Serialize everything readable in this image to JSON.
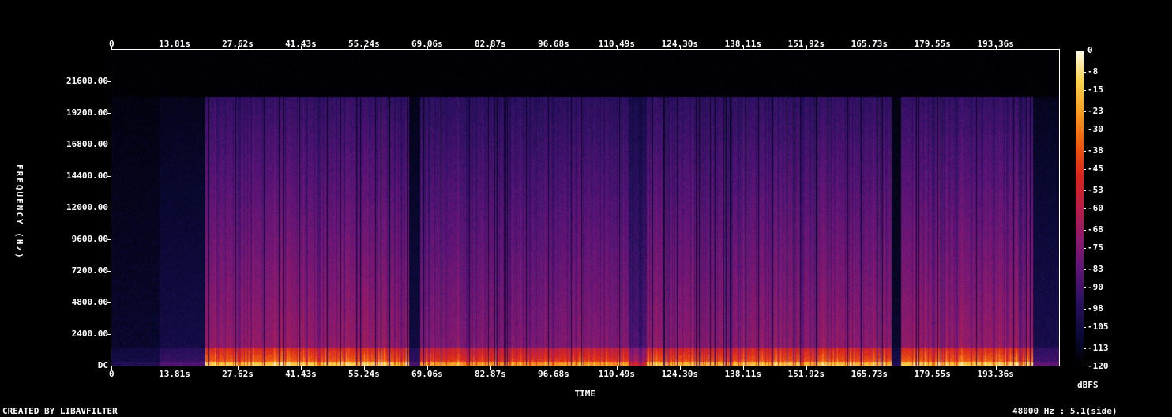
{
  "chart_data": {
    "type": "heatmap",
    "title": "",
    "xlabel": "TIME",
    "ylabel": "FREQUENCY (Hz)",
    "x_ticks": [
      "0",
      "13.81s",
      "27.62s",
      "41.43s",
      "55.24s",
      "69.06s",
      "82.87s",
      "96.68s",
      "110.49s",
      "124.30s",
      "138.11s",
      "151.92s",
      "165.73s",
      "179.55s",
      "193.36s"
    ],
    "y_ticks": [
      "DC",
      "2400.00",
      "4800.00",
      "7200.00",
      "9600.00",
      "12000.00",
      "14400.00",
      "16800.00",
      "19200.00",
      "21600.00"
    ],
    "x_range_s": [
      0,
      207.2
    ],
    "y_range_hz": [
      0,
      24000
    ],
    "energy_cutoff_hz": 20400,
    "colorbar_ticks": [
      "0",
      "-8",
      "-15",
      "-23",
      "-30",
      "-38",
      "-45",
      "-53",
      "-60",
      "-68",
      "-75",
      "-83",
      "-90",
      "-98",
      "-105",
      "-113",
      "-120"
    ],
    "colorbar_label": "dBFS",
    "colorbar_range_db": [
      -120,
      0
    ],
    "colors": [
      "#000000",
      "#0b0a3a",
      "#2a1060",
      "#5b1478",
      "#8a1a6e",
      "#b81e4a",
      "#d8241e",
      "#ee5a10",
      "#f89a20",
      "#fcd24a",
      "#fffbe8"
    ],
    "time_profile": [
      {
        "t0": 0,
        "t1": 10.5,
        "level": 0.12
      },
      {
        "t0": 10.5,
        "t1": 20.5,
        "level": 0.2
      },
      {
        "t0": 20.5,
        "t1": 65.0,
        "level": 0.62
      },
      {
        "t0": 65.0,
        "t1": 67.5,
        "level": 0.18
      },
      {
        "t0": 67.5,
        "t1": 113.0,
        "level": 0.56
      },
      {
        "t0": 113.0,
        "t1": 117.0,
        "level": 0.4
      },
      {
        "t0": 117.0,
        "t1": 170.5,
        "level": 0.6
      },
      {
        "t0": 170.5,
        "t1": 172.5,
        "level": 0.12
      },
      {
        "t0": 172.5,
        "t1": 201.5,
        "level": 0.62
      },
      {
        "t0": 201.5,
        "t1": 207.2,
        "level": 0.22
      }
    ]
  },
  "footer": {
    "left": "CREATED BY LIBAVFILTER",
    "right": "48000 Hz : 5.1(side)"
  }
}
